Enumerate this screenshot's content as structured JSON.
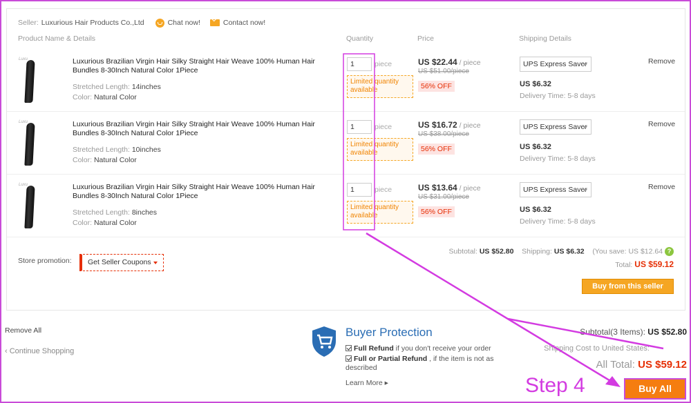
{
  "seller": {
    "label": "Seller:",
    "name": "Luxurious Hair Products Co.,Ltd",
    "chat": "Chat now!",
    "contact": "Contact now!"
  },
  "columns": {
    "product": "Product Name & Details",
    "quantity": "Quantity",
    "price": "Price",
    "shipping": "Shipping Details"
  },
  "items": [
    {
      "title": "Luxurious Brazilian Virgin Hair Silky Straight Hair Weave 100% Human Hair Bundles 8-30Inch Natural Color 1Piece",
      "length_label": "Stretched Length:",
      "length": "14inches",
      "color_label": "Color:",
      "color": "Natural Color",
      "qty": "1",
      "unit": "piece",
      "limited": "Limited quantity available",
      "price": "US $22.44",
      "price_unit": " / piece",
      "old_price": "US $51.00/piece",
      "off": "56% OFF",
      "ship_method": "UPS Express Saver",
      "ship_cost": "US $6.32",
      "delivery": "Delivery Time: 5-8 days",
      "remove": "Remove"
    },
    {
      "title": "Luxurious Brazilian Virgin Hair Silky Straight Hair Weave 100% Human Hair Bundles 8-30Inch Natural Color 1Piece",
      "length_label": "Stretched Length:",
      "length": "10inches",
      "color_label": "Color:",
      "color": "Natural Color",
      "qty": "1",
      "unit": "piece",
      "limited": "Limited quantity available",
      "price": "US $16.72",
      "price_unit": " / piece",
      "old_price": "US $38.00/piece",
      "off": "56% OFF",
      "ship_method": "UPS Express Saver",
      "ship_cost": "US $6.32",
      "delivery": "Delivery Time: 5-8 days",
      "remove": "Remove"
    },
    {
      "title": "Luxurious Brazilian Virgin Hair Silky Straight Hair Weave 100% Human Hair Bundles 8-30Inch Natural Color 1Piece",
      "length_label": "Stretched Length:",
      "length": "8inches",
      "color_label": "Color:",
      "color": "Natural Color",
      "qty": "1",
      "unit": "piece",
      "limited": "Limited quantity available",
      "price": "US $13.64",
      "price_unit": " / piece",
      "old_price": "US $31.00/piece",
      "off": "56% OFF",
      "ship_method": "UPS Express Saver",
      "ship_cost": "US $6.32",
      "delivery": "Delivery Time: 5-8 days",
      "remove": "Remove"
    }
  ],
  "promo": {
    "label": "Store promotion:",
    "coupon": "Get Seller Coupons"
  },
  "seller_summary": {
    "subtotal_label": "Subtotal:",
    "subtotal": "US $52.80",
    "shipping_label": "Shipping:",
    "shipping": "US $6.32",
    "save": "(You save: US $12.64",
    "total_label": "Total:",
    "total": "US $59.12",
    "buy_button": "Buy from this seller"
  },
  "footer": {
    "remove_all": "Remove All",
    "continue": "‹ Continue Shopping",
    "bp_title": "Buyer Protection",
    "bp_full_b": "Full Refund",
    "bp_full": " if you don't receive your order",
    "bp_partial_b": "Full or Partial Refund",
    "bp_partial": " , if the item is not as described",
    "learn_more": "Learn More ▸"
  },
  "order_summary": {
    "items_label": "Subtotal(3 Items):",
    "items_total": "US $52.80",
    "ship_to": "Shipping Cost to United States:",
    "all_total_label": "All Total:",
    "all_total": "US $59.12",
    "buy_all": "Buy All"
  },
  "annotation": {
    "step": "Step 4",
    "color": "#d33be1"
  },
  "colors": {
    "accent": "#f5a623",
    "price_red": "#e62e04",
    "protection_blue": "#2a6db4"
  }
}
